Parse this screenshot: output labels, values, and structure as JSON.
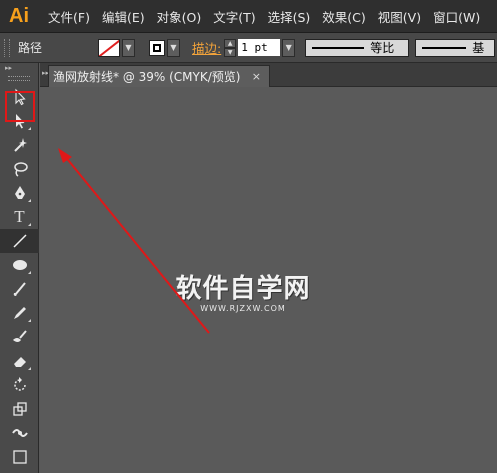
{
  "app": {
    "logo": "Ai"
  },
  "menu": [
    "文件(F)",
    "编辑(E)",
    "对象(O)",
    "文字(T)",
    "选择(S)",
    "效果(C)",
    "视图(V)",
    "窗口(W)"
  ],
  "control": {
    "path_label": "路径",
    "stroke_label": "描边:",
    "stroke_weight": "1 pt",
    "profile_label": "等比",
    "brush_label": "基"
  },
  "document": {
    "tab_title": "渔网放射线* @ 39% (CMYK/预览)",
    "close": "×"
  },
  "watermark": {
    "title": "软件自学网",
    "url": "WWW.RJZXW.COM"
  },
  "tools": [
    {
      "name": "selection-tool",
      "icon": "arrow-icon"
    },
    {
      "name": "direct-selection-tool",
      "icon": "white-arrow-icon"
    },
    {
      "name": "magic-wand-tool",
      "icon": "wand-icon"
    },
    {
      "name": "lasso-tool",
      "icon": "lasso-icon"
    },
    {
      "name": "pen-tool",
      "icon": "pen-icon"
    },
    {
      "name": "type-tool",
      "icon": "type-icon",
      "glyph": "T"
    },
    {
      "name": "line-segment-tool",
      "icon": "line-icon"
    },
    {
      "name": "ellipse-tool",
      "icon": "ellipse-icon"
    },
    {
      "name": "paintbrush-tool",
      "icon": "brush-icon"
    },
    {
      "name": "pencil-tool",
      "icon": "pencil-icon"
    },
    {
      "name": "blob-brush-tool",
      "icon": "blob-brush-icon"
    },
    {
      "name": "eraser-tool",
      "icon": "eraser-icon"
    },
    {
      "name": "rotate-tool",
      "icon": "rotate-icon"
    },
    {
      "name": "scale-tool",
      "icon": "scale-icon"
    },
    {
      "name": "width-tool",
      "icon": "width-icon"
    },
    {
      "name": "free-transform-tool",
      "icon": "free-transform-icon"
    }
  ],
  "colors": {
    "annotation_red": "#e01818",
    "logo_orange": "#f7a01c"
  }
}
